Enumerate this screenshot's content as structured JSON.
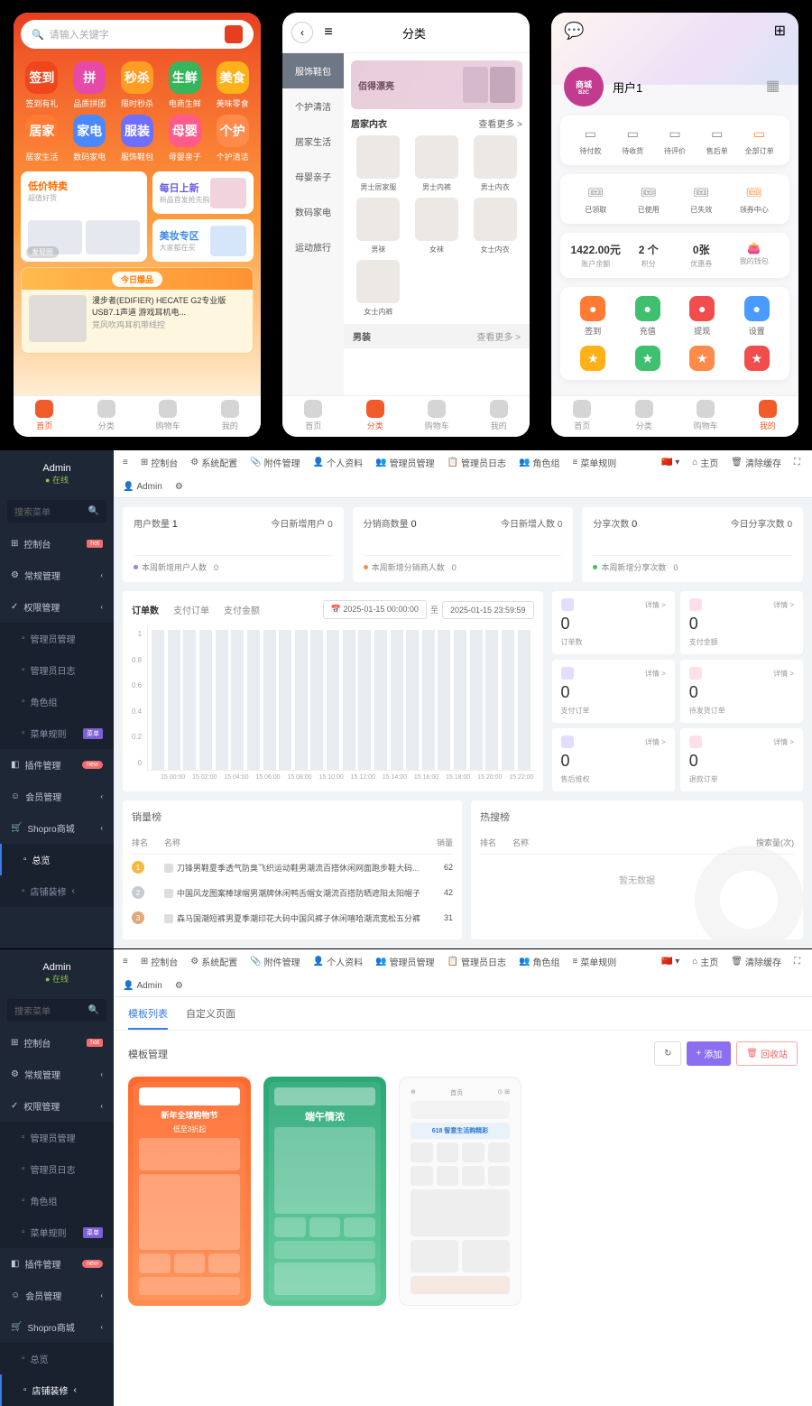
{
  "phone1": {
    "search_placeholder": "请输入关键字",
    "nav_grid": [
      {
        "label": "签到有礼",
        "short": "签到",
        "color": "#f1451b"
      },
      {
        "label": "品质拼团",
        "short": "拼",
        "color": "#e64aa8"
      },
      {
        "label": "限时秒杀",
        "short": "秒杀",
        "color": "#ff9d22"
      },
      {
        "label": "电商生鲜",
        "short": "生鲜",
        "color": "#36b55d"
      },
      {
        "label": "美味零食",
        "short": "美食",
        "color": "#ffb11a"
      },
      {
        "label": "居家生活",
        "short": "居家",
        "color": "#ff7a33"
      },
      {
        "label": "数码家电",
        "short": "家电",
        "color": "#4a88ff"
      },
      {
        "label": "服饰鞋包",
        "short": "服装",
        "color": "#6e6eff"
      },
      {
        "label": "母婴亲子",
        "short": "母婴",
        "color": "#ff5a8a"
      },
      {
        "label": "个护清洁",
        "short": "个护",
        "color": "#ff8a4a"
      }
    ],
    "card_left_title": "低价特卖",
    "card_left_sub": "超值好货",
    "card_r1_title": "每日上新",
    "card_r1_sub": "新品首发抢先购",
    "card_r2_title": "美妆专区",
    "card_r2_sub": "大家都在买",
    "today_tag": "今日爆品",
    "today_product_title": "漫步者(EDIFIER) HECATE G2专业版 USB7.1声道 游戏耳机电...",
    "today_product_sub": "竞风吹鸡耳机带线控",
    "card_left_corner": "发现圈",
    "tabs": [
      {
        "label": "首页",
        "active": true
      },
      {
        "label": "分类",
        "active": false
      },
      {
        "label": "购物车",
        "active": false
      },
      {
        "label": "我的",
        "active": false
      }
    ]
  },
  "phone2": {
    "title": "分类",
    "categories": [
      {
        "label": "服饰鞋包",
        "active": true
      },
      {
        "label": "个护清洁"
      },
      {
        "label": "居家生活"
      },
      {
        "label": "母婴亲子"
      },
      {
        "label": "数码家电"
      },
      {
        "label": "运动旅行"
      }
    ],
    "banner_text": "佰得漂亮",
    "section1": {
      "title": "居家内衣",
      "more": "查看更多 >",
      "items": [
        "男士居家服",
        "男士内裤",
        "男士内衣",
        "男袜",
        "女袜",
        "女士内衣",
        "女士内裤"
      ]
    },
    "section2": {
      "title": "男装",
      "more": "查看更多 >"
    },
    "tabs": [
      {
        "label": "首页"
      },
      {
        "label": "分类",
        "active": true
      },
      {
        "label": "购物车"
      },
      {
        "label": "我的"
      }
    ]
  },
  "phone3": {
    "avatar_top": "商城",
    "avatar_sub": "B2C",
    "username": "用户1",
    "orders": [
      {
        "label": "待付款"
      },
      {
        "label": "待收货"
      },
      {
        "label": "待评价"
      },
      {
        "label": "售后单"
      },
      {
        "label": "全部订单",
        "accent": true
      }
    ],
    "coupons": [
      {
        "label": "已领取"
      },
      {
        "label": "已使用"
      },
      {
        "label": "已失效"
      },
      {
        "label": "领券中心",
        "accent": true
      }
    ],
    "wallet": [
      {
        "val": "1422.00元",
        "lbl": "账户余额"
      },
      {
        "val": "2 个",
        "lbl": "积分"
      },
      {
        "val": "0张",
        "lbl": "优惠券"
      },
      {
        "val": "",
        "lbl": "我的钱包",
        "icon": true
      }
    ],
    "actions": [
      {
        "label": "签到",
        "color": "#ff7a33"
      },
      {
        "label": "充值",
        "color": "#3fc06e"
      },
      {
        "label": "提现",
        "color": "#f24d4d"
      },
      {
        "label": "设置",
        "color": "#4a9bff"
      }
    ],
    "action_icons": [
      {
        "color": "#ffb11a"
      },
      {
        "color": "#3fc06e"
      },
      {
        "color": "#ff8a4a"
      },
      {
        "color": "#f24d4d"
      }
    ],
    "tabs": [
      {
        "label": "首页"
      },
      {
        "label": "分类"
      },
      {
        "label": "购物车"
      },
      {
        "label": "我的",
        "active": true
      }
    ]
  },
  "admin": {
    "user": "Admin",
    "status": "● 在线",
    "search_placeholder": "搜索菜单",
    "nav": [
      {
        "label": "控制台",
        "icon": "⊞",
        "badge": "hot"
      },
      {
        "label": "常规管理",
        "icon": "⚙",
        "chev": true
      },
      {
        "label": "权限管理",
        "icon": "✓",
        "chev": true,
        "expand": true
      },
      {
        "label": "管理员管理",
        "sub": true
      },
      {
        "label": "管理员日志",
        "sub": true
      },
      {
        "label": "角色组",
        "sub": true
      },
      {
        "label": "菜单规则",
        "sub": true,
        "badge": "star"
      },
      {
        "label": "插件管理",
        "icon": "◧",
        "badge": "new"
      },
      {
        "label": "会员管理",
        "icon": "☺",
        "chev": true
      },
      {
        "label": "Shopro商城",
        "icon": "🛒",
        "chev": true,
        "expand": true
      },
      {
        "label": "总览",
        "sub": true,
        "active": true
      },
      {
        "label": "店铺装修",
        "sub": true,
        "chev": true
      }
    ],
    "topbar": [
      {
        "label": "控制台",
        "icon": "⊞"
      },
      {
        "label": "系统配置",
        "icon": "⚙"
      },
      {
        "label": "附件管理",
        "icon": "📎"
      },
      {
        "label": "个人资料",
        "icon": "👤"
      },
      {
        "label": "管理员管理",
        "icon": "👥"
      },
      {
        "label": "管理员日志",
        "icon": "📋"
      },
      {
        "label": "角色组",
        "icon": "👥"
      },
      {
        "label": "菜单规则",
        "icon": "≡"
      }
    ],
    "topbar_right": [
      {
        "label": "主页",
        "icon": "⌂"
      },
      {
        "label": "清除缓存",
        "icon": "🗑"
      },
      {
        "label": "",
        "icon": "⛶"
      },
      {
        "label": "Admin",
        "icon": "👤"
      },
      {
        "label": "",
        "icon": "⚙"
      }
    ],
    "topbar_lang": "🇨🇳 ▾",
    "stats": [
      {
        "title": "用户数量",
        "val": "1",
        "right": "今日新增用户 0",
        "bot": "本周新增用户人数",
        "botval": "0",
        "dot": "#9c7cf0"
      },
      {
        "title": "分销商数量",
        "val": "0",
        "right": "今日新增人数 0",
        "bot": "本周新增分销商人数",
        "botval": "0",
        "dot": "#ff8a4a"
      },
      {
        "title": "分享次数",
        "val": "0",
        "right": "今日分享次数 0",
        "bot": "本周新增分享次数",
        "botval": "0",
        "dot": "#3fc06e"
      }
    ],
    "order_chart": {
      "tabs": [
        "订单数",
        "支付订单",
        "支付金额"
      ],
      "date_from": "2025-01-15 00:00:00",
      "date_to": "2025-01-15 23:59:59",
      "date_sep": "至",
      "y": [
        "1",
        "0.8",
        "0.6",
        "0.4",
        "0.2",
        "0"
      ],
      "x": [
        "15 00:00",
        "15 02:00",
        "15 04:00",
        "15 06:00",
        "15 08:00",
        "15 10:00",
        "15 12:00",
        "15 14:00",
        "15 16:00",
        "15 18:00",
        "15 20:00",
        "15 22:00"
      ]
    },
    "order_stats": [
      {
        "val": "0",
        "lbl": "订单数",
        "chip": "#e5ddff",
        "detail": "详情 >"
      },
      {
        "val": "0",
        "lbl": "支付金额",
        "chip": "#ffe0e8",
        "detail": "详情 >"
      },
      {
        "val": "0",
        "lbl": "支付订单",
        "chip": "#e5ddff",
        "detail": "详情 >"
      },
      {
        "val": "0",
        "lbl": "待发货订单",
        "chip": "#ffe0e8",
        "detail": "详情 >"
      },
      {
        "val": "0",
        "lbl": "售后维权",
        "chip": "#e5ddff",
        "detail": "详情 >"
      },
      {
        "val": "0",
        "lbl": "退款订单",
        "chip": "#ffe0e8",
        "detail": "详情 >"
      }
    ],
    "sales_table": {
      "title": "销量榜",
      "cols": [
        "排名",
        "名称",
        "销量"
      ],
      "rows": [
        {
          "rank": 1,
          "name": "刀锋男鞋夏季透气防臭飞织运动鞋男潮流百搭休闲网面跑步鞋大码...",
          "val": "62",
          "color": "#f5b942"
        },
        {
          "rank": 2,
          "name": "中国风龙图案棒球帽男潮牌休闲鸭舌帽女潮流百搭防晒遮阳太阳帽子",
          "val": "42",
          "color": "#c7cbd1"
        },
        {
          "rank": 3,
          "name": "森马国潮短裤男夏季潮印花大码中国风裤子休闲嘻哈潮流宽松五分裤",
          "val": "31",
          "color": "#e0a97c"
        }
      ]
    },
    "hot_table": {
      "title": "热搜榜",
      "cols": [
        "排名",
        "名称",
        "搜索量(次)"
      ],
      "empty": "暂无数据"
    }
  },
  "admin2": {
    "user": "Admin",
    "status": "● 在线",
    "search_placeholder": "搜索菜单",
    "nav": [
      {
        "label": "控制台",
        "icon": "⊞",
        "badge": "hot"
      },
      {
        "label": "常规管理",
        "icon": "⚙",
        "chev": true
      },
      {
        "label": "权限管理",
        "icon": "✓",
        "chev": true,
        "expand": true
      },
      {
        "label": "管理员管理",
        "sub": true
      },
      {
        "label": "管理员日志",
        "sub": true
      },
      {
        "label": "角色组",
        "sub": true
      },
      {
        "label": "菜单规则",
        "sub": true,
        "badge": "star"
      },
      {
        "label": "插件管理",
        "icon": "◧",
        "badge": "new"
      },
      {
        "label": "会员管理",
        "icon": "☺",
        "chev": true
      },
      {
        "label": "Shopro商城",
        "icon": "🛒",
        "chev": true,
        "expand": true
      },
      {
        "label": "总览",
        "sub": true
      },
      {
        "label": "店铺装修",
        "sub": true,
        "chev": true,
        "active": true
      }
    ],
    "tabs": [
      "模板列表",
      "自定义页面"
    ],
    "panel_title": "模板管理",
    "btn_add": "添加",
    "btn_trash": "回收站",
    "btn_refresh": "↻",
    "templates": [
      {
        "title": "新年全球购物节",
        "sub": "低至3折起"
      },
      {
        "title": "端午情浓"
      },
      {
        "title": "618 智意生活购精彩"
      }
    ]
  }
}
